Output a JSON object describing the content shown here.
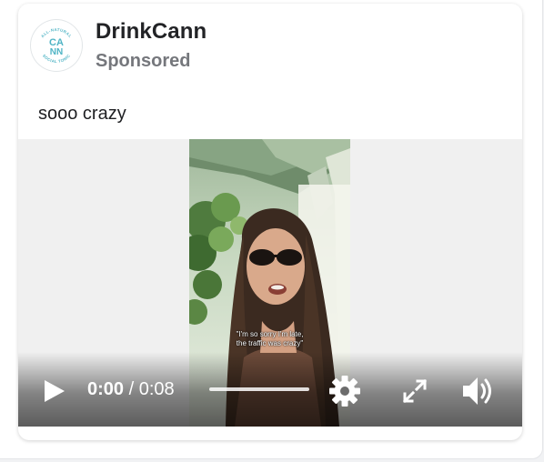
{
  "post": {
    "brand_name": "DrinkCann",
    "sponsored_label": "Sponsored",
    "text": "sooo crazy",
    "avatar_logo": {
      "top_arc": "ALL-NATURAL",
      "line1": "CA",
      "line2": "NN",
      "bottom_arc": "SOCIAL TONIC",
      "color": "#4fb4c5"
    }
  },
  "video": {
    "caption_line1": "\"I'm so sorry I'm late,",
    "caption_line2": "the traffic was crazy\"",
    "current_time": "0:00",
    "time_separator": " / ",
    "duration": "0:08",
    "progress_fraction": 0,
    "icons": {
      "play": "play-icon",
      "settings": "gear-icon",
      "fullscreen": "fullscreen-icon",
      "volume": "volume-icon"
    }
  },
  "colors": {
    "brand_text": "#222326",
    "sponsored_text": "#75777c",
    "logo_teal": "#4fb4c5",
    "video_background": "#f0f0f0"
  }
}
